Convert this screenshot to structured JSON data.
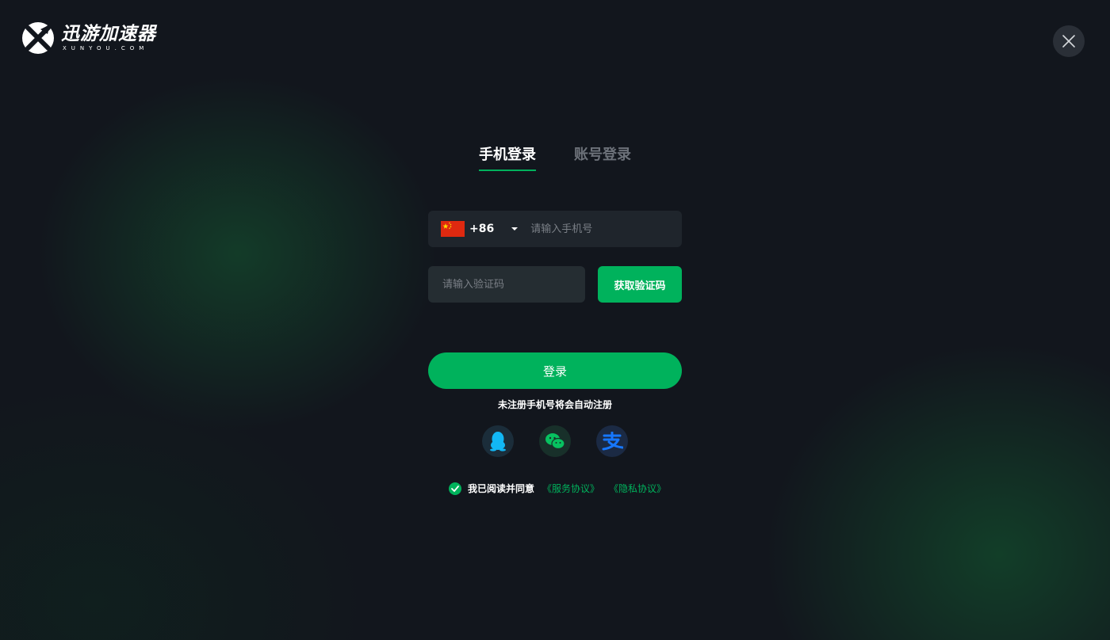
{
  "brand": {
    "name_cn": "迅游加速器",
    "domain": "XUNYOU.COM",
    "logo_icon": "xunyou-logo-icon"
  },
  "window": {
    "close_icon": "close-icon"
  },
  "tabs": [
    {
      "label": "手机登录",
      "active": true
    },
    {
      "label": "账号登录",
      "active": false
    }
  ],
  "phone": {
    "flag_icon": "china-flag-icon",
    "country_code": "+86",
    "dropdown_icon": "caret-down-icon",
    "placeholder": "请输入手机号",
    "value": ""
  },
  "verify": {
    "placeholder": "请输入验证码",
    "value": "",
    "get_code_label": "获取验证码"
  },
  "login_label": "登录",
  "auto_register_hint": "未注册手机号将会自动注册",
  "social": [
    {
      "name": "qq-icon",
      "color": "#12b7f5"
    },
    {
      "name": "wechat-icon",
      "color": "#07c160"
    },
    {
      "name": "alipay-icon",
      "color": "#1677ff"
    }
  ],
  "agreement": {
    "checked": true,
    "text": "我已阅读并同意",
    "service_link": "《服务协议》",
    "privacy_link": "《隐私协议》"
  },
  "colors": {
    "accent": "#00b25c",
    "background": "#12161d",
    "input_bg": "#1f252c"
  }
}
